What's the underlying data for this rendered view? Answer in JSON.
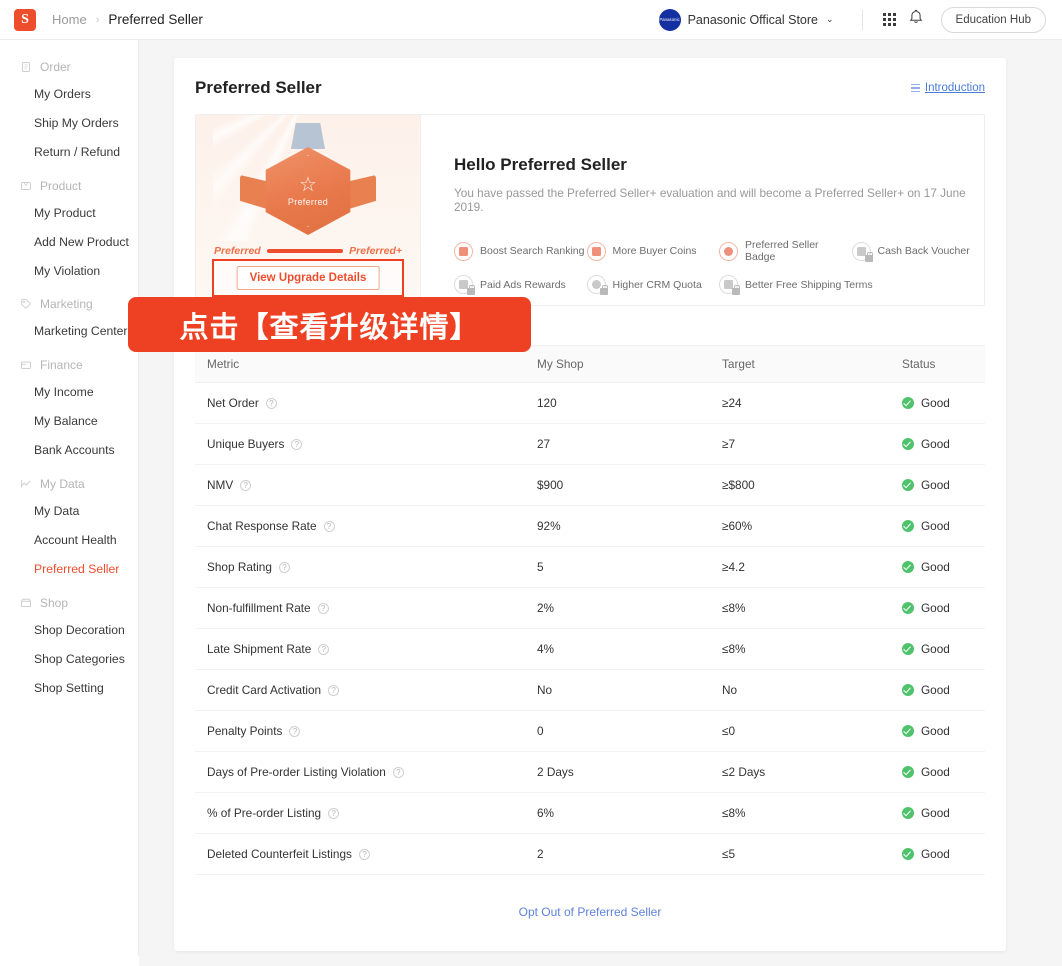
{
  "topbar": {
    "logo_alt": "shopee-logo",
    "breadcrumb_home": "Home",
    "breadcrumb_sep": "›",
    "breadcrumb_current": "Preferred Seller",
    "shop_name": "Panasonic Offical Store",
    "avatar_text": "Panasonic",
    "caret": "⌄",
    "education_hub": "Education Hub"
  },
  "sidebar": {
    "groups": [
      {
        "label": "Order",
        "icon": "clipboard-icon",
        "items": [
          {
            "label": "My Orders",
            "active": false
          },
          {
            "label": "Ship My Orders",
            "active": false
          },
          {
            "label": "Return / Refund",
            "active": false
          }
        ]
      },
      {
        "label": "Product",
        "icon": "box-icon",
        "items": [
          {
            "label": "My Product",
            "active": false
          },
          {
            "label": "Add New Product",
            "active": false
          },
          {
            "label": "My Violation",
            "active": false
          }
        ]
      },
      {
        "label": "Marketing",
        "icon": "tag-icon",
        "items": [
          {
            "label": "Marketing Center",
            "active": false
          }
        ]
      },
      {
        "label": "Finance",
        "icon": "wallet-icon",
        "items": [
          {
            "label": "My Income",
            "active": false
          },
          {
            "label": "My Balance",
            "active": false
          },
          {
            "label": "Bank Accounts",
            "active": false
          }
        ]
      },
      {
        "label": "My Data",
        "icon": "chart-icon",
        "items": [
          {
            "label": "My Data",
            "active": false
          },
          {
            "label": "Account Health",
            "active": false
          },
          {
            "label": "Preferred Seller",
            "active": true
          }
        ]
      },
      {
        "label": "Shop",
        "icon": "store-icon",
        "items": [
          {
            "label": "Shop Decoration",
            "active": false
          },
          {
            "label": "Shop Categories",
            "active": false
          },
          {
            "label": "Shop Setting",
            "active": false
          }
        ]
      }
    ]
  },
  "page": {
    "title": "Preferred Seller",
    "introduction_link": "Introduction"
  },
  "hero": {
    "badge_star": "☆",
    "badge_label": "Preferred",
    "progress_from": "Preferred",
    "progress_to": "Preferred+",
    "upgrade_button": "View Upgrade Details",
    "greeting": "Hello Preferred Seller",
    "message": "You have passed the Preferred Seller+ evaluation and will become a Preferred Seller+ on 17 June 2019.",
    "perks": [
      {
        "label": "Boost Search Ranking",
        "icon": "search-rank-icon",
        "locked": false
      },
      {
        "label": "More Buyer Coins",
        "icon": "coins-icon",
        "locked": false
      },
      {
        "label": "Preferred Seller Badge",
        "icon": "badge-icon",
        "locked": false
      },
      {
        "label": "Cash Back Voucher",
        "icon": "voucher-icon",
        "locked": true
      },
      {
        "label": "Paid Ads Rewards",
        "icon": "ads-icon",
        "locked": true
      },
      {
        "label": "Higher CRM Quota",
        "icon": "crm-icon",
        "locked": true
      },
      {
        "label": "Better Free Shipping Terms",
        "icon": "shipping-icon",
        "locked": true
      }
    ]
  },
  "table": {
    "columns": [
      "Metric",
      "My Shop",
      "Target",
      "Status"
    ],
    "rows": [
      {
        "metric": "Net Order",
        "my_shop": "120",
        "target": "≥24",
        "status": "Good"
      },
      {
        "metric": "Unique Buyers",
        "my_shop": "27",
        "target": "≥7",
        "status": "Good"
      },
      {
        "metric": "NMV",
        "my_shop": "$900",
        "target": "≥$800",
        "status": "Good"
      },
      {
        "metric": "Chat Response Rate",
        "my_shop": "92%",
        "target": "≥60%",
        "status": "Good"
      },
      {
        "metric": "Shop Rating",
        "my_shop": "5",
        "target": "≥4.2",
        "status": "Good"
      },
      {
        "metric": "Non-fulfillment Rate",
        "my_shop": "2%",
        "target": "≤8%",
        "status": "Good"
      },
      {
        "metric": "Late Shipment Rate",
        "my_shop": "4%",
        "target": "≤8%",
        "status": "Good"
      },
      {
        "metric": "Credit Card Activation",
        "my_shop": "No",
        "target": "No",
        "status": "Good"
      },
      {
        "metric": "Penalty Points",
        "my_shop": "0",
        "target": "≤0",
        "status": "Good"
      },
      {
        "metric": "Days of Pre-order Listing Violation",
        "my_shop": "2 Days",
        "target": "≤2 Days",
        "status": "Good"
      },
      {
        "metric": "% of Pre-order Listing",
        "my_shop": "6%",
        "target": "≤8%",
        "status": "Good"
      },
      {
        "metric": "Deleted Counterfeit Listings",
        "my_shop": "2",
        "target": "≤5",
        "status": "Good"
      }
    ],
    "help_glyph": "?"
  },
  "footer": {
    "opt_out": "Opt Out of Preferred Seller"
  },
  "annotation": {
    "text": "点击【查看升级详情】",
    "color": "#ee4124"
  },
  "colors": {
    "brand": "#ee4d2d",
    "good": "#4fc36b",
    "link": "#5d83d8",
    "highlight": "#ee4124"
  }
}
